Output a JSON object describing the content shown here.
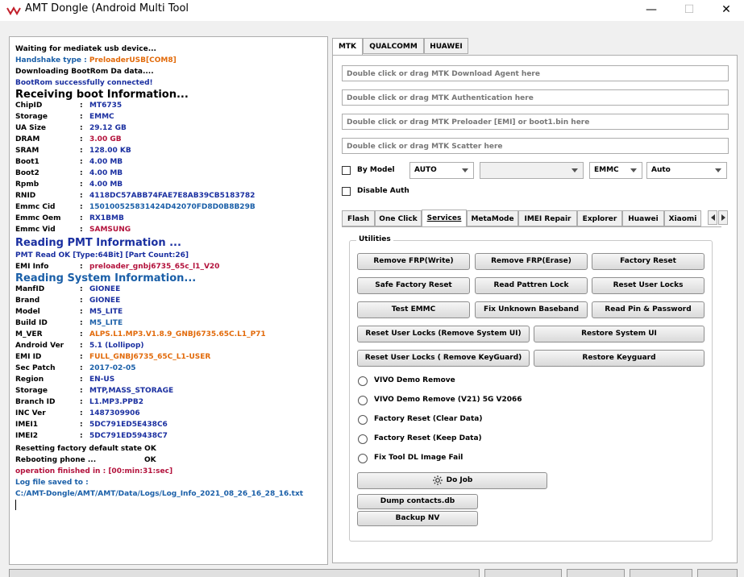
{
  "window": {
    "title": "AMT Dongle (Android Multi Tool",
    "minimize": "—",
    "maximize": "☐",
    "close": "✕"
  },
  "log": {
    "l1": "Waiting for mediatek usb device...",
    "handshake_label": "Handshake type :",
    "handshake_value": "PreloaderUSB[COM8]",
    "l3": "Downloading BootRom Da data....",
    "l4": "BootRom successfully connected!",
    "h_boot": "Receiving boot Information...",
    "boot": [
      {
        "k": "ChipID",
        "v": "MT6735"
      },
      {
        "k": "Storage",
        "v": "EMMC"
      },
      {
        "k": "UA Size",
        "v": "29.12 GB"
      },
      {
        "k": "DRAM",
        "v": "3.00 GB"
      },
      {
        "k": "SRAM",
        "v": "128.00 KB"
      },
      {
        "k": "Boot1",
        "v": "4.00 MB"
      },
      {
        "k": "Boot2",
        "v": "4.00 MB"
      },
      {
        "k": "Rpmb",
        "v": "4.00 MB"
      },
      {
        "k": "RNID",
        "v": "4118DC57ABB74FAE7E8AB39CB5183782"
      },
      {
        "k": "Emmc Cid",
        "v": "150100525831424D42070FD8D0B8B29B"
      },
      {
        "k": "Emmc Oem",
        "v": "RX1BMB"
      },
      {
        "k": "Emmc Vid",
        "v": "SAMSUNG"
      }
    ],
    "h_pmt": "Reading PMT Information ...",
    "pmt_line": "PMT Read OK [Type:64Bit] [Part Count:26]",
    "emi_label": "EMI Info",
    "emi_value": "preloader_gnbj6735_65c_l1_V20",
    "h_sys": "Reading System Information...",
    "sys": [
      {
        "k": "ManfID",
        "v": "GIONEE"
      },
      {
        "k": "Brand",
        "v": "GIONEE"
      },
      {
        "k": "Model",
        "v": "M5_LITE"
      },
      {
        "k": "Build ID",
        "v": "M5_LITE"
      },
      {
        "k": "M_VER",
        "v": "ALPS.L1.MP3.V1.8.9_GNBJ6735.65C.L1_P71"
      },
      {
        "k": "Android Ver",
        "v": "5.1 (Lollipop)"
      },
      {
        "k": "EMI ID",
        "v": "FULL_GNBJ6735_65C_L1-USER"
      },
      {
        "k": "Sec Patch",
        "v": "2017-02-05"
      },
      {
        "k": "Region",
        "v": "EN-US"
      },
      {
        "k": "Storage",
        "v": "MTP,MASS_STORAGE"
      },
      {
        "k": "Branch ID",
        "v": "L1.MP3.PPB2"
      },
      {
        "k": "INC Ver",
        "v": "1487309906"
      },
      {
        "k": "IMEI1",
        "v": "5DC791ED5E438C6"
      },
      {
        "k": "IMEI2",
        "v": "5DC791ED59438C7"
      }
    ],
    "reset_state": "Resetting factory default state",
    "ok1": "OK",
    "rebooting": "Rebooting phone ...",
    "ok2": "OK",
    "finished": "operation finished in : [00:min:31:sec]",
    "log_saved": "Log file saved to :",
    "log_path": "C:/AMT-Dongle/AMT/AMT/Data/Logs/Log_Info_2021_08_26_16_28_16.txt"
  },
  "vendor_tabs": [
    "MTK",
    "QUALCOMM",
    "HUAWEI"
  ],
  "fields": [
    "Double click or drag MTK Download Agent here",
    "Double click or drag MTK Authentication here",
    "Double click or drag MTK Preloader [EMI] or boot1.bin here",
    "Double click or drag MTK Scatter here"
  ],
  "options": {
    "by_model": "By Model",
    "combo_mode": "AUTO",
    "combo_model": "",
    "combo_storage": "EMMC",
    "combo_auto": "Auto",
    "disable_auth": "Disable Auth"
  },
  "sub_tabs": [
    "Flash",
    "One Click",
    "Services",
    "MetaMode",
    "IMEI Repair",
    "Explorer",
    "Huawei",
    "Xiaomi"
  ],
  "utilities": {
    "title": "Utilities",
    "btn_remove_frp_write": "Remove FRP(Write)",
    "btn_remove_frp_erase": "Remove FRP(Erase)",
    "btn_factory_reset": "Factory Reset",
    "btn_safe_factory_reset": "Safe Factory Reset",
    "btn_read_pattern": "Read Pattren Lock",
    "btn_reset_user_locks": "Reset User Locks",
    "btn_test_emmc": "Test EMMC",
    "btn_fix_baseband": "Fix Unknown Baseband",
    "btn_read_pin": "Read Pin & Password",
    "btn_reset_locks_system_ui": "Reset User Locks (Remove System UI)",
    "btn_restore_system_ui": "Restore System UI",
    "btn_reset_locks_keyguard": "Reset User Locks ( Remove KeyGuard)",
    "btn_restore_keyguard": "Restore Keyguard",
    "radios": [
      "VIVO Demo Remove",
      "VIVO Demo Remove (V21) 5G V2066",
      "Factory Reset (Clear Data)",
      "Factory Reset (Keep Data)",
      "Fix Tool DL Image Fail"
    ],
    "btn_do_job": "Do Job",
    "btn_dump_contacts": "Dump contacts.db",
    "btn_backup_nv": "Backup NV"
  },
  "colors": {
    "log_blue": "#1a5fa8",
    "log_navy": "#1a2fa0",
    "log_orange": "#e26a0a",
    "log_red": "#b3123c"
  }
}
